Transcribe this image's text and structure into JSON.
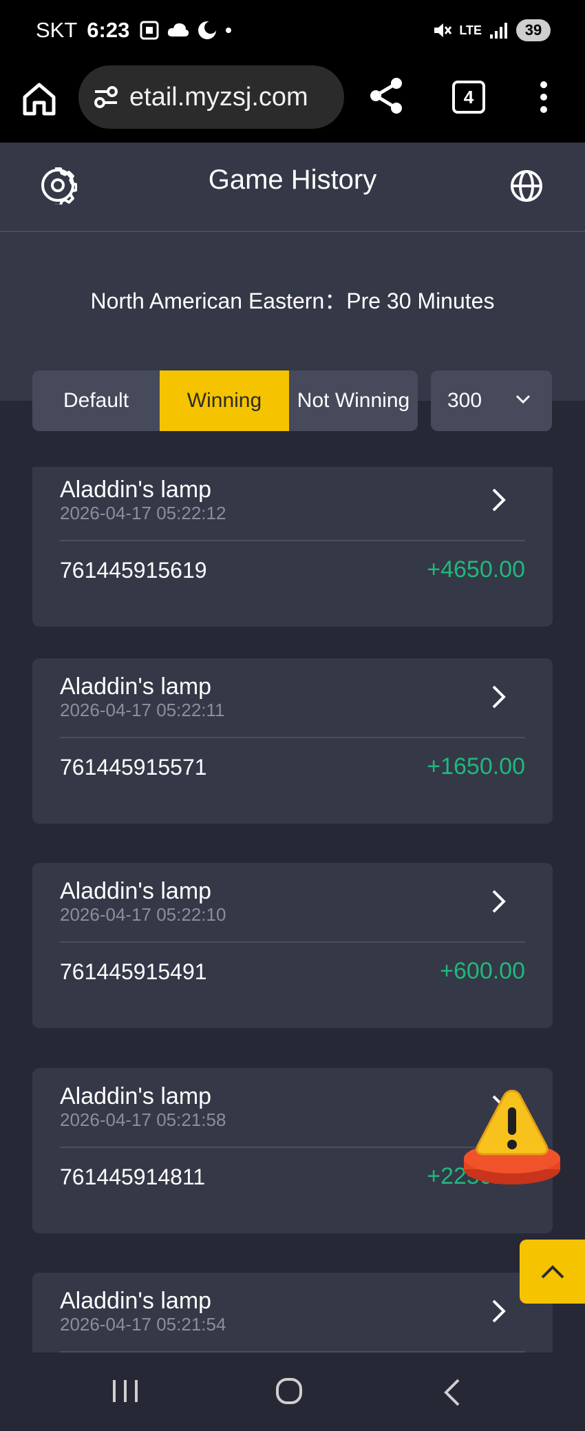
{
  "status_bar": {
    "carrier": "SKT",
    "time": "6:23",
    "network": "LTE",
    "battery": "39"
  },
  "browser": {
    "url": "etail.myzsj.com",
    "tab_count": "4"
  },
  "header": {
    "title": "Game History"
  },
  "filter": {
    "timezone_label": "North American Eastern：Pre 30 Minutes",
    "segments": [
      "Default",
      "Winning",
      "Not Winning"
    ],
    "active_segment": "Winning",
    "count_selected": "300"
  },
  "records": [
    {
      "game": "Aladdin's lamp",
      "time": "2026-04-17 05:22:12",
      "id": "761445915619",
      "amount": "+4650.00"
    },
    {
      "game": "Aladdin's lamp",
      "time": "2026-04-17 05:22:11",
      "id": "761445915571",
      "amount": "+1650.00"
    },
    {
      "game": "Aladdin's lamp",
      "time": "2026-04-17 05:22:10",
      "id": "761445915491",
      "amount": "+600.00"
    },
    {
      "game": "Aladdin's lamp",
      "time": "2026-04-17 05:21:58",
      "id": "761445914811",
      "amount": "+2250.00"
    },
    {
      "game": "Aladdin's lamp",
      "time": "2026-04-17 05:21:54",
      "id": "",
      "amount": ""
    }
  ],
  "colors": {
    "accent": "#f6c300",
    "background": "#262835",
    "panel": "#353847",
    "positive": "#1fb97a"
  }
}
